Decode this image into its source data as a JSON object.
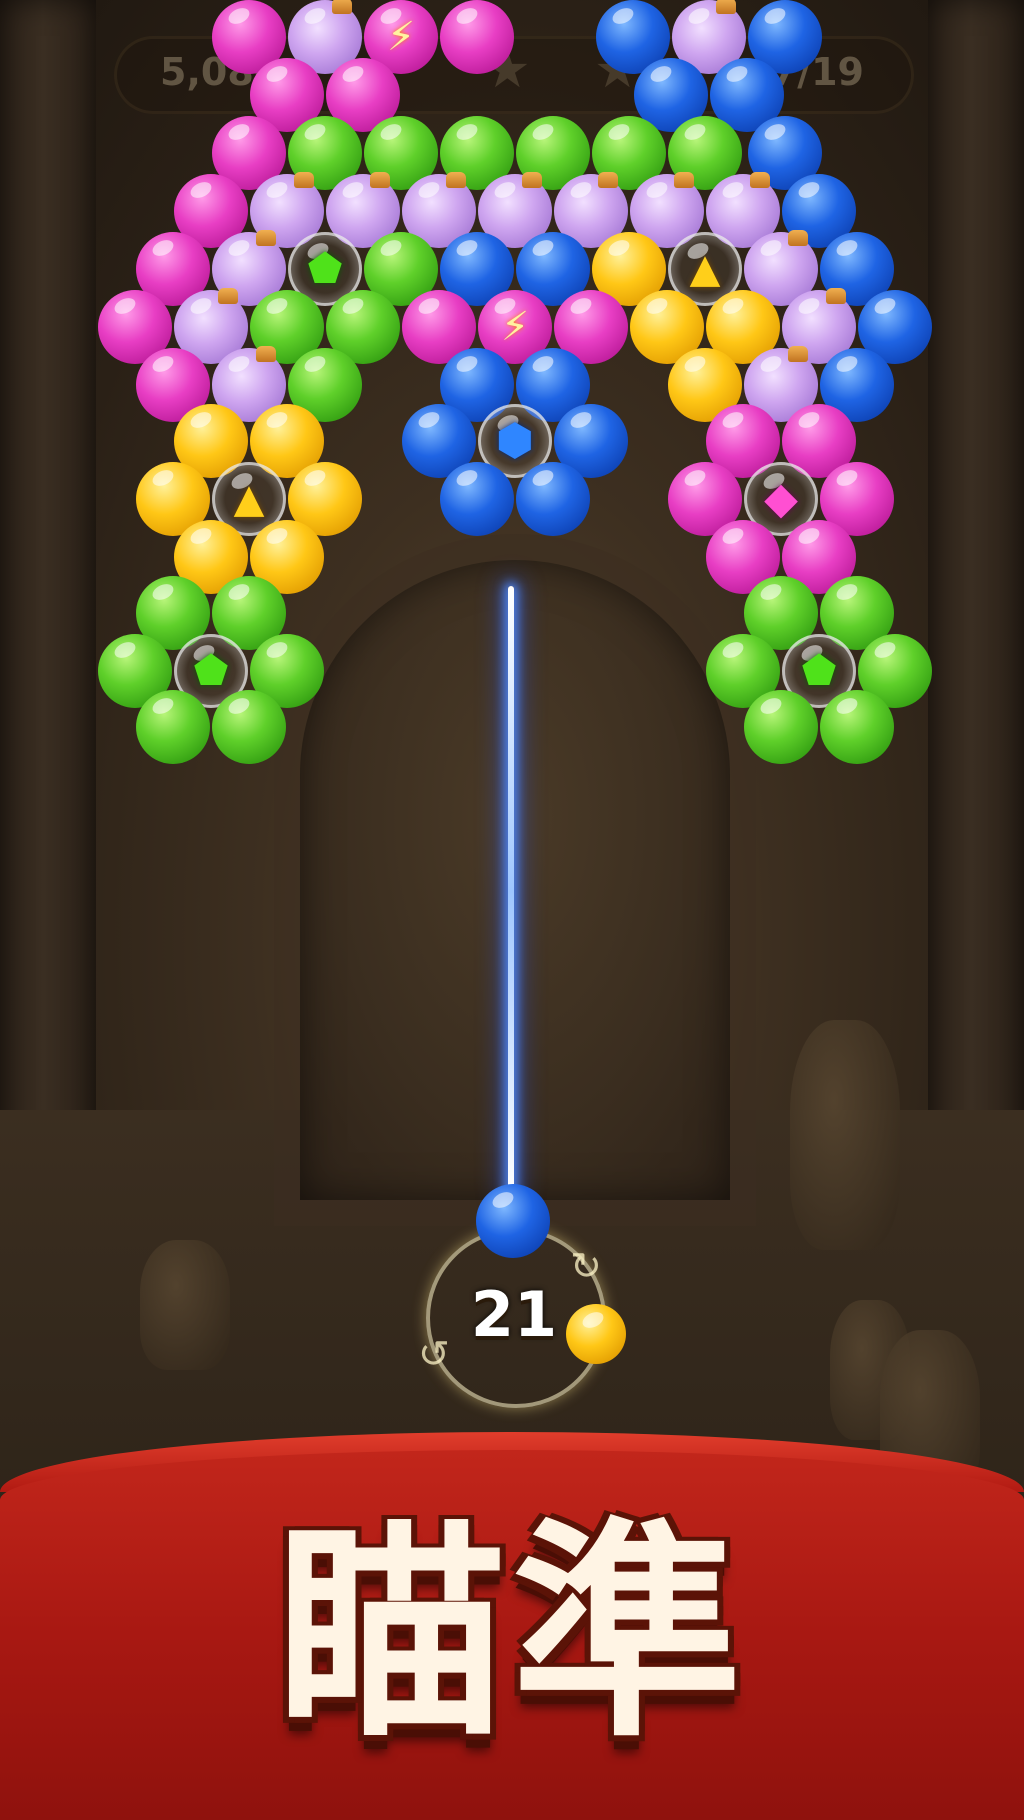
{
  "hud": {
    "score": "5,080",
    "moves_progress": "7/19"
  },
  "shooter": {
    "moves_left": "21",
    "current_color": "blue",
    "next_color": "yellow"
  },
  "banner": {
    "text": "瞄準"
  },
  "colors": {
    "green": "#5fd02a",
    "pink": "#e83ec4",
    "blue": "#1f64e4",
    "yellow": "#ffc716",
    "potion": "#cfa6f0",
    "banner_red": "#b11a12",
    "banner_text": "#fff4e4"
  },
  "icons": {
    "gem": "gem-icon",
    "lightning": "lightning-icon",
    "star": "star-icon"
  },
  "board": [
    [
      "pink",
      "potion",
      "bolt-pink",
      "pink",
      "",
      "",
      "",
      "",
      "",
      "blue",
      "potion",
      "blue"
    ],
    [
      "pink",
      "pink",
      "",
      "",
      "",
      "",
      "",
      "",
      "",
      "blue",
      "blue",
      ""
    ],
    [
      "pink",
      "green",
      "green",
      "green",
      "green",
      "green",
      "green",
      "blue",
      "",
      "",
      "",
      ""
    ],
    [
      "pink",
      "potion",
      "potion",
      "potion",
      "potion",
      "potion",
      "potion",
      "potion",
      "blue",
      "",
      "",
      ""
    ],
    [
      "pink",
      "potion",
      "gem-green",
      "green",
      "blue",
      "blue",
      "yellow",
      "gem-yellow",
      "potion",
      "blue",
      "",
      ""
    ],
    [
      "pink",
      "potion",
      "green",
      "green",
      "pink",
      "bolt-pink",
      "pink",
      "yellow",
      "yellow",
      "potion",
      "blue",
      ""
    ],
    [
      "pink",
      "potion",
      "green",
      "",
      "blue",
      "blue",
      "",
      "yellow",
      "potion",
      "blue",
      "",
      ""
    ],
    [
      "yellow",
      "yellow",
      "",
      "blue",
      "gem-blue",
      "blue",
      "",
      "pink",
      "pink",
      "",
      "",
      ""
    ],
    [
      "yellow",
      "gem-yellow",
      "yellow",
      "",
      "blue",
      "blue",
      "",
      "pink",
      "gem-pink",
      "pink",
      "",
      ""
    ],
    [
      "yellow",
      "yellow",
      "",
      "",
      "",
      "",
      "",
      "pink",
      "pink",
      "",
      "",
      ""
    ],
    [
      "green",
      "green",
      "",
      "",
      "",
      "",
      "",
      "green",
      "green",
      "",
      "",
      ""
    ],
    [
      "green",
      "gem-green",
      "green",
      "",
      "",
      "",
      "",
      "green",
      "gem-green",
      "green",
      "",
      ""
    ],
    [
      "green",
      "green",
      "",
      "",
      "",
      "",
      "",
      "green",
      "green",
      "",
      "",
      ""
    ]
  ]
}
